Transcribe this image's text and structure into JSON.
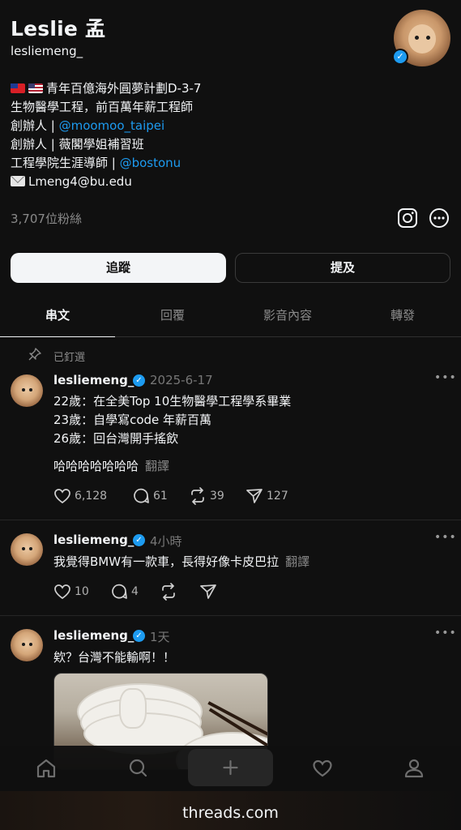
{
  "profile": {
    "name": "Leslie 孟",
    "handle": "lesliemeng_",
    "bio": {
      "line1": "青年百億海外圓夢計劃D-3-7",
      "line2": "生物醫學工程，前百萬年薪工程師",
      "line3_prefix": "創辦人 | ",
      "line3_link": "@moomoo_taipei",
      "line4": "創辦人 | 薇閣學姐補習班",
      "line5_prefix": "工程學院生涯導師 | ",
      "line5_link": "@bostonu",
      "line6": "Lmeng4@bu.edu"
    },
    "followers": "3,707位粉絲"
  },
  "buttons": {
    "follow": "追蹤",
    "mention": "提及"
  },
  "tabs": [
    {
      "label": "串文",
      "active": true
    },
    {
      "label": "回覆",
      "active": false
    },
    {
      "label": "影音內容",
      "active": false
    },
    {
      "label": "轉發",
      "active": false
    }
  ],
  "pinned_label": "已釘選",
  "posts": [
    {
      "username": "lesliemeng_",
      "time": "2025-6-17",
      "lines": [
        "22歲：在全美Top 10生物醫學工程學系畢業",
        "23歲：自學寫code 年薪百萬",
        "26歲：回台灣開手搖飲"
      ],
      "extra": "哈哈哈哈哈哈哈",
      "translate": "翻譯",
      "likes": "6,128",
      "replies": "61",
      "reposts": "39",
      "shares": "127"
    },
    {
      "username": "lesliemeng_",
      "time": "4小時",
      "lines": [
        "我覺得BMW有一款車，長得好像卡皮巴拉"
      ],
      "translate": "翻譯",
      "likes": "10",
      "replies": "4"
    },
    {
      "username": "lesliemeng_",
      "time": "1天",
      "lines": [
        "欸？台灣不能輸啊！！"
      ]
    }
  ],
  "browser": {
    "url": "threads.com"
  },
  "colors": {
    "accent": "#1d9bf0",
    "background": "#101010",
    "text": "#f3f5f7",
    "muted": "#8a8a8a"
  }
}
